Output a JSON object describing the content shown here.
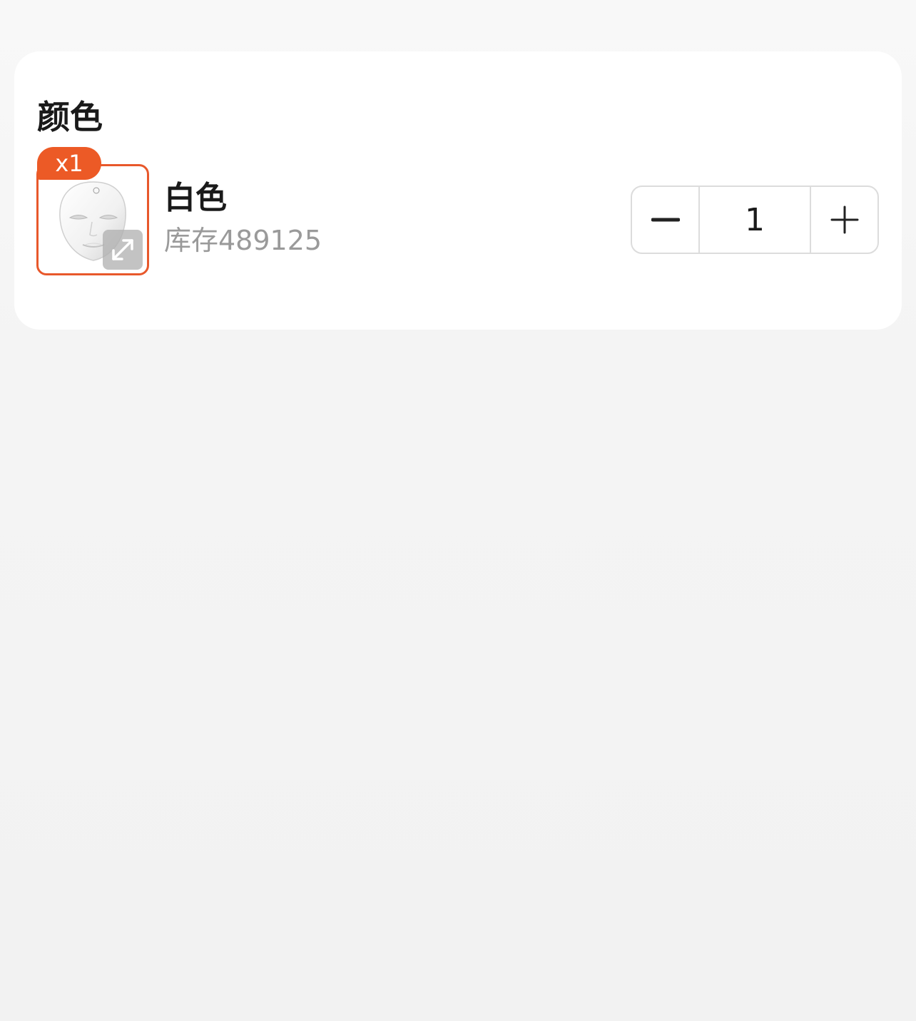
{
  "spec_section": {
    "title": "颜色",
    "option": {
      "badge": "x1",
      "name": "白色",
      "stock": "库存489125",
      "image_icon": "face-mask-image",
      "expand_icon": "expand-icon"
    }
  },
  "quantity": {
    "value": "1",
    "minus_icon": "minus-icon",
    "plus_icon": "plus-icon"
  },
  "colors": {
    "accent": "#ec5a26",
    "border_selected": "#e8582b",
    "text_primary": "#1a1a1a",
    "text_secondary": "#9a9a9a",
    "background": "#f3f3f3",
    "card": "#ffffff"
  }
}
